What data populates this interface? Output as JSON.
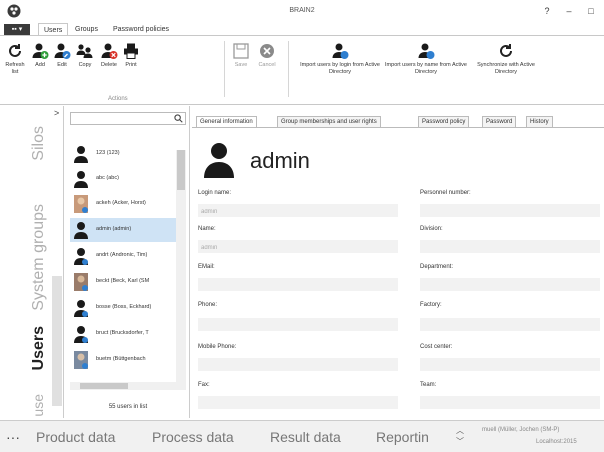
{
  "window": {
    "title": "BRAIN2",
    "help": "?",
    "minimize": "–",
    "maximize": "□"
  },
  "ribbon_tabs": {
    "app_menu": "▪▪ ▾",
    "tabs": [
      "Users",
      "Groups",
      "Password policies"
    ]
  },
  "ribbon": {
    "refresh": "Refresh list",
    "add": "Add",
    "edit": "Edit",
    "copy": "Copy",
    "delete": "Delete",
    "print": "Print",
    "group_actions": "Actions",
    "save": "Save",
    "cancel": "Cancel",
    "import_login": "Import users by login from Active Directory",
    "import_name": "Import users by name from Active Directory",
    "sync": "Synchronize with Active Directory"
  },
  "leftnav": {
    "collapse": ">",
    "silos": "Silos",
    "system_groups": "System groups",
    "users": "Users",
    "use": "use"
  },
  "list": {
    "search_value": "",
    "users": [
      "123 (123)",
      "abc (abc)",
      "ackeh (Acker, Horst)",
      "admin (admin)",
      "andrt (Andronic, Tim)",
      "beckt (Beck, Karl (SM",
      "bosse (Boss, Eckhard)",
      "bruct (Brucksdorfer, T",
      "buetm (Büttgenbach"
    ],
    "count": "55 users in list"
  },
  "detail": {
    "tabs": [
      "General information",
      "Group memberships and user rights",
      "Password policy",
      "Password",
      "History"
    ],
    "name": "admin",
    "login_name_label": "Login name:",
    "login_name_value": "admin",
    "name_label": "Name:",
    "name_value": "admin",
    "email_label": "EMail:",
    "phone_label": "Phone:",
    "mobile_label": "Mobile Phone:",
    "fax_label": "Fax:",
    "personnel_label": "Personnel number:",
    "division_label": "Division:",
    "department_label": "Department:",
    "factory_label": "Factory:",
    "cost_center_label": "Cost center:",
    "team_label": "Team:"
  },
  "bottom": {
    "more": "···",
    "product": "Product data",
    "process": "Process data",
    "result": "Result data",
    "reporting": "Reportin",
    "user": "muell (Müller, Jochen (SM-P)",
    "server": "Localhost:2015"
  },
  "colors": {
    "accent": "#2f7fd0",
    "selected": "#cfe3f5",
    "icon_dark": "#1a1a1a",
    "delete_red": "#d9342b"
  }
}
